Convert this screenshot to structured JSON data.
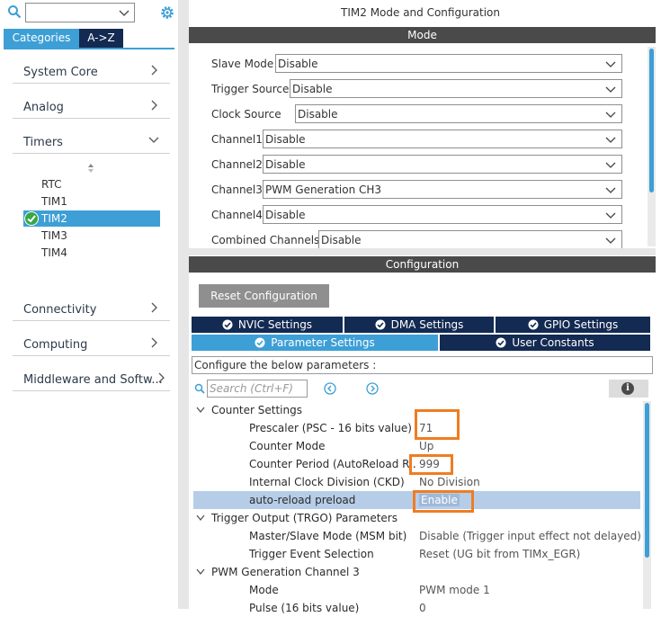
{
  "left": {
    "tabs": {
      "categories": "Categories",
      "az": "A->Z"
    },
    "categories": [
      {
        "label": "System Core"
      },
      {
        "label": "Analog"
      },
      {
        "label": "Timers"
      },
      {
        "label": "Connectivity"
      },
      {
        "label": "Computing"
      },
      {
        "label": "Middleware and Softw..."
      }
    ],
    "timers_items": [
      "RTC",
      "TIM1",
      "TIM2",
      "TIM3",
      "TIM4"
    ],
    "selected_item": "TIM2"
  },
  "right": {
    "title": "TIM2 Mode and Configuration",
    "mode_header": "Mode",
    "mode_rows": [
      {
        "label": "Slave Mode",
        "value": "Disable"
      },
      {
        "label": "Trigger Source",
        "value": "Disable"
      },
      {
        "label": "Clock Source",
        "value": "Disable"
      },
      {
        "label": "Channel1",
        "value": "Disable"
      },
      {
        "label": "Channel2",
        "value": "Disable"
      },
      {
        "label": "Channel3",
        "value": "PWM Generation CH3"
      },
      {
        "label": "Channel4",
        "value": "Disable"
      },
      {
        "label": "Combined Channels",
        "value": "Disable"
      }
    ],
    "config_header": "Configuration",
    "reset_button": "Reset Configuration",
    "tabs_row1": [
      "NVIC Settings",
      "DMA Settings",
      "GPIO Settings"
    ],
    "tabs_row2": [
      "Parameter Settings",
      "User Constants"
    ],
    "configure_text": "Configure the below parameters :",
    "search_placeholder": "Search (Ctrl+F)",
    "sections": [
      {
        "title": "Counter Settings",
        "rows": [
          {
            "label": "Prescaler (PSC - 16 bits value)",
            "value": "71"
          },
          {
            "label": "Counter Mode",
            "value": "Up"
          },
          {
            "label": "Counter Period (AutoReload R...",
            "value": "999"
          },
          {
            "label": "Internal Clock Division (CKD)",
            "value": "No Division"
          },
          {
            "label": "auto-reload preload",
            "value": "Enable"
          }
        ]
      },
      {
        "title": "Trigger Output (TRGO) Parameters",
        "rows": [
          {
            "label": "Master/Slave Mode (MSM bit)",
            "value": "Disable (Trigger input effect not delayed)"
          },
          {
            "label": "Trigger Event Selection",
            "value": "Reset (UG bit from TIMx_EGR)"
          }
        ]
      },
      {
        "title": "PWM Generation Channel 3",
        "rows": [
          {
            "label": "Mode",
            "value": "PWM mode 1"
          },
          {
            "label": "Pulse (16 bits value)",
            "value": "0"
          }
        ]
      }
    ]
  },
  "colors": {
    "accent": "#3d9fd6",
    "navy": "#132a52",
    "header": "#4a4a4a",
    "highlight": "#ef7d22",
    "selected_row": "#b6cde8"
  },
  "icons": [
    "search-icon",
    "gear-icon",
    "chevron-down-icon",
    "chevron-right-icon",
    "check-circle-icon",
    "info-icon",
    "arrow-left-icon",
    "arrow-right-icon",
    "expand-caret-icon"
  ]
}
